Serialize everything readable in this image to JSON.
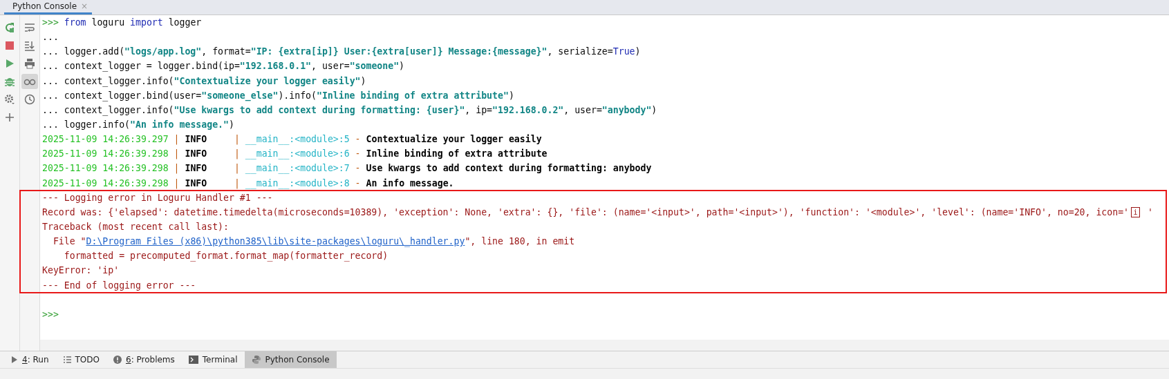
{
  "tool_window": {
    "tab": {
      "label": "Python Console",
      "close": "×",
      "selected": true
    }
  },
  "toolbar_left": [
    {
      "kind": "rerun"
    },
    {
      "kind": "stop"
    },
    {
      "kind": "run"
    },
    {
      "kind": "debug"
    },
    {
      "kind": "settings"
    },
    {
      "kind": "add"
    }
  ],
  "toolbar_right": [
    {
      "kind": "wrap",
      "selected": false
    },
    {
      "kind": "scroll-end",
      "selected": false
    },
    {
      "kind": "print",
      "selected": false
    },
    {
      "kind": "glasses",
      "selected": true
    },
    {
      "kind": "history",
      "selected": false
    }
  ],
  "console_lines": [
    [
      {
        "kind": "prompt",
        "text": ">>> "
      },
      {
        "kind": "keyword",
        "text": "from"
      },
      {
        "kind": "plain",
        "text": " loguru "
      },
      {
        "kind": "keyword",
        "text": "import"
      },
      {
        "kind": "plain",
        "text": " logger"
      }
    ],
    [
      {
        "kind": "plain",
        "text": "..."
      }
    ],
    [
      {
        "kind": "plain",
        "text": "... logger.add("
      },
      {
        "kind": "string",
        "text": "\"logs/app.log\""
      },
      {
        "kind": "plain",
        "text": ", format="
      },
      {
        "kind": "string",
        "text": "\"IP: {extra[ip]} User:{extra[user]} Message:{message}\""
      },
      {
        "kind": "plain",
        "text": ", serialize="
      },
      {
        "kind": "keyword",
        "text": "True"
      },
      {
        "kind": "plain",
        "text": ")"
      }
    ],
    [
      {
        "kind": "plain",
        "text": "... context_logger = logger.bind(ip="
      },
      {
        "kind": "string",
        "text": "\"192.168.0.1\""
      },
      {
        "kind": "plain",
        "text": ", user="
      },
      {
        "kind": "string",
        "text": "\"someone\""
      },
      {
        "kind": "plain",
        "text": ")"
      }
    ],
    [
      {
        "kind": "plain",
        "text": "... context_logger.info("
      },
      {
        "kind": "string",
        "text": "\"Contextualize your logger easily\""
      },
      {
        "kind": "plain",
        "text": ")"
      }
    ],
    [
      {
        "kind": "plain",
        "text": "... context_logger.bind(user="
      },
      {
        "kind": "string",
        "text": "\"someone_else\""
      },
      {
        "kind": "plain",
        "text": ").info("
      },
      {
        "kind": "string",
        "text": "\"Inline binding of extra attribute\""
      },
      {
        "kind": "plain",
        "text": ")"
      }
    ],
    [
      {
        "kind": "plain",
        "text": "... context_logger.info("
      },
      {
        "kind": "string",
        "text": "\"Use kwargs to add context during formatting: {user}\""
      },
      {
        "kind": "plain",
        "text": ", ip="
      },
      {
        "kind": "string",
        "text": "\"192.168.0.2\""
      },
      {
        "kind": "plain",
        "text": ", user="
      },
      {
        "kind": "string",
        "text": "\"anybody\""
      },
      {
        "kind": "plain",
        "text": ")"
      }
    ],
    [
      {
        "kind": "plain",
        "text": "... logger.info("
      },
      {
        "kind": "string",
        "text": "\"An info message.\""
      },
      {
        "kind": "plain",
        "text": ")"
      }
    ],
    [
      {
        "kind": "timestamp",
        "text": "2025-11-09 14:26:39.297"
      },
      {
        "kind": "separator",
        "text": " | "
      },
      {
        "kind": "level",
        "text": "INFO    "
      },
      {
        "kind": "separator",
        "text": " | "
      },
      {
        "kind": "module",
        "text": "__main__:<module>:5"
      },
      {
        "kind": "separator",
        "text": " - "
      },
      {
        "kind": "message",
        "text": "Contextualize your logger easily"
      }
    ],
    [
      {
        "kind": "timestamp",
        "text": "2025-11-09 14:26:39.298"
      },
      {
        "kind": "separator",
        "text": " | "
      },
      {
        "kind": "level",
        "text": "INFO    "
      },
      {
        "kind": "separator",
        "text": " | "
      },
      {
        "kind": "module",
        "text": "__main__:<module>:6"
      },
      {
        "kind": "separator",
        "text": " - "
      },
      {
        "kind": "message",
        "text": "Inline binding of extra attribute"
      }
    ],
    [
      {
        "kind": "timestamp",
        "text": "2025-11-09 14:26:39.298"
      },
      {
        "kind": "separator",
        "text": " | "
      },
      {
        "kind": "level",
        "text": "INFO    "
      },
      {
        "kind": "separator",
        "text": " | "
      },
      {
        "kind": "module",
        "text": "__main__:<module>:7"
      },
      {
        "kind": "separator",
        "text": " - "
      },
      {
        "kind": "message",
        "text": "Use kwargs to add context during formatting: anybody"
      }
    ],
    [
      {
        "kind": "timestamp",
        "text": "2025-11-09 14:26:39.298"
      },
      {
        "kind": "separator",
        "text": " | "
      },
      {
        "kind": "level",
        "text": "INFO    "
      },
      {
        "kind": "separator",
        "text": " | "
      },
      {
        "kind": "module",
        "text": "__main__:<module>:8"
      },
      {
        "kind": "separator",
        "text": " - "
      },
      {
        "kind": "message",
        "text": "An info message."
      }
    ],
    [
      {
        "kind": "error",
        "text": "--- Logging error in Loguru Handler #1 ---"
      }
    ],
    [
      {
        "kind": "error",
        "text": "Record was: {'elapsed': datetime.timedelta(microseconds=10389), 'exception': None, 'extra': {}, 'file': (name='<input>', path='<input>'), 'function': '<module>', 'level': (name='INFO', no=20, icon='"
      },
      {
        "kind": "glyph",
        "text": "i"
      },
      {
        "kind": "error",
        "text": " '"
      }
    ],
    [
      {
        "kind": "error",
        "text": "Traceback (most recent call last):"
      }
    ],
    [
      {
        "kind": "error",
        "text": "  File \""
      },
      {
        "kind": "link",
        "text": "D:\\Program Files (x86)\\python385\\lib\\site-packages\\loguru\\_handler.py"
      },
      {
        "kind": "error",
        "text": "\", line 180, in emit"
      }
    ],
    [
      {
        "kind": "error",
        "text": "    formatted = precomputed_format.format_map(formatter_record)"
      }
    ],
    [
      {
        "kind": "error",
        "text": "KeyError: 'ip'"
      }
    ],
    [
      {
        "kind": "error",
        "text": "--- End of logging error ---"
      }
    ],
    [
      {
        "kind": "prompt",
        "text": ">>>"
      }
    ]
  ],
  "bottom_tabs": [
    {
      "kind": "run",
      "mnemonic": "4",
      "label": ": Run",
      "selected": false
    },
    {
      "kind": "todo",
      "label": "TODO",
      "selected": false
    },
    {
      "kind": "problems",
      "mnemonic": "6",
      "label": ": Problems",
      "selected": false
    },
    {
      "kind": "terminal",
      "label": "Terminal",
      "selected": false
    },
    {
      "kind": "python",
      "label": "Python Console",
      "selected": true
    }
  ]
}
